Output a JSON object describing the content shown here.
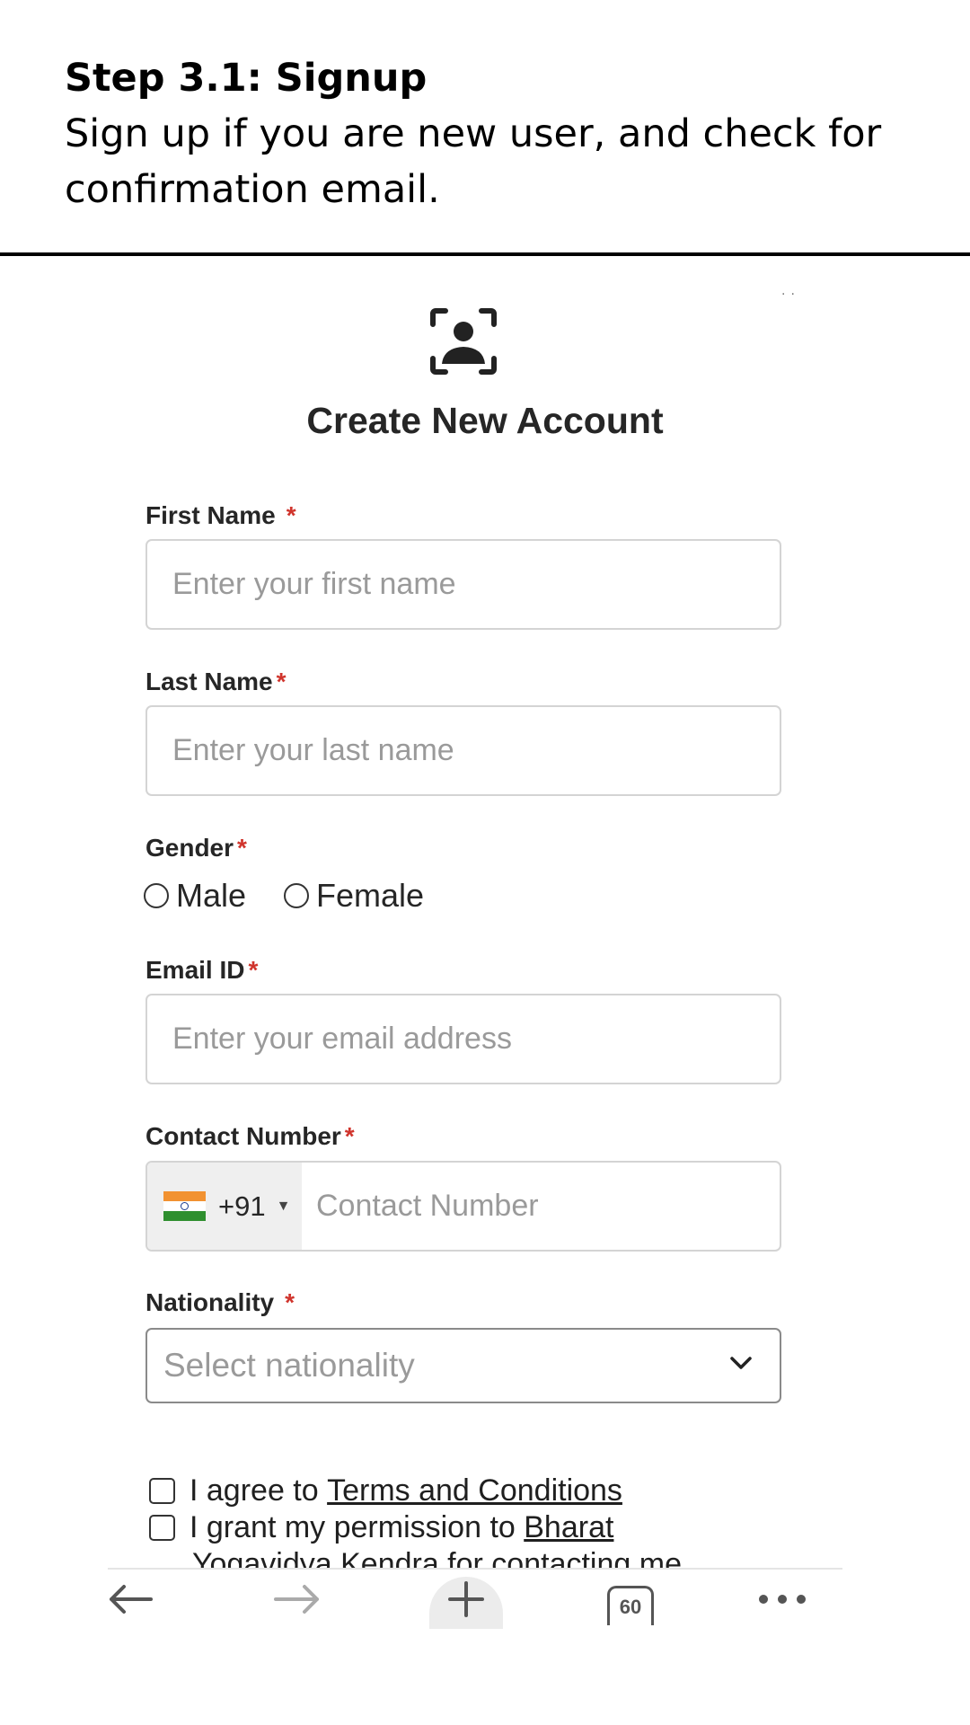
{
  "step": {
    "title": "Step 3.1: Signup",
    "description": "Sign up if you are new user, and check for confirmation email."
  },
  "form": {
    "title": "Create New Account",
    "required_marker": "*",
    "first_name": {
      "label": "First Name",
      "placeholder": "Enter your first name",
      "value": ""
    },
    "last_name": {
      "label": "Last Name",
      "placeholder": "Enter your last name",
      "value": ""
    },
    "gender": {
      "label": "Gender",
      "options": [
        "Male",
        "Female"
      ],
      "selected": null
    },
    "email": {
      "label": "Email ID",
      "placeholder": "Enter your email address",
      "value": ""
    },
    "contact": {
      "label": "Contact Number",
      "country_code": "+91",
      "placeholder": "Contact Number",
      "value": ""
    },
    "nationality": {
      "label": "Nationality",
      "placeholder": "Select nationality"
    },
    "terms": {
      "prefix": "I agree to ",
      "link": "Terms and Conditions",
      "checked": false
    },
    "permission": {
      "prefix": "I grant my permission to ",
      "link": "Bharat",
      "continuation": "Yogavidya Kendra for contacting me",
      "checked": false
    }
  },
  "browser_nav": {
    "tab_count": "60",
    "icons": [
      "back-arrow-icon",
      "forward-arrow-icon",
      "plus-icon",
      "tabs-icon",
      "more-dots-icon"
    ]
  },
  "colors": {
    "required": "#d0342c",
    "placeholder": "#9a9a9a",
    "text": "#262626"
  }
}
